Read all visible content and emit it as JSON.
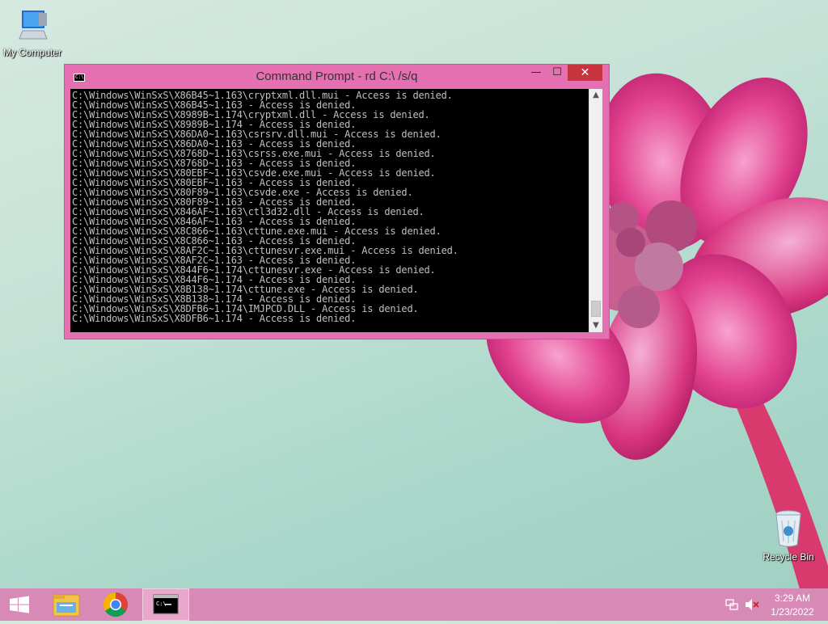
{
  "desktop": {
    "icons": [
      {
        "label": "My Computer"
      },
      {
        "label": "Recycle Bin"
      }
    ]
  },
  "window": {
    "title": "Command Prompt - rd  C:\\ /s/q",
    "controls": {
      "minimize": "—",
      "maximize": "☐",
      "close": "✕"
    },
    "console_lines": [
      "C:\\Windows\\WinSxS\\X86B45~1.163\\cryptxml.dll.mui - Access is denied.",
      "C:\\Windows\\WinSxS\\X86B45~1.163 - Access is denied.",
      "C:\\Windows\\WinSxS\\X8989B~1.174\\cryptxml.dll - Access is denied.",
      "C:\\Windows\\WinSxS\\X8989B~1.174 - Access is denied.",
      "C:\\Windows\\WinSxS\\X86DA0~1.163\\csrsrv.dll.mui - Access is denied.",
      "C:\\Windows\\WinSxS\\X86DA0~1.163 - Access is denied.",
      "C:\\Windows\\WinSxS\\X8768D~1.163\\csrss.exe.mui - Access is denied.",
      "C:\\Windows\\WinSxS\\X8768D~1.163 - Access is denied.",
      "C:\\Windows\\WinSxS\\X80EBF~1.163\\csvde.exe.mui - Access is denied.",
      "C:\\Windows\\WinSxS\\X80EBF~1.163 - Access is denied.",
      "C:\\Windows\\WinSxS\\X80F89~1.163\\csvde.exe - Access is denied.",
      "C:\\Windows\\WinSxS\\X80F89~1.163 - Access is denied.",
      "C:\\Windows\\WinSxS\\X846AF~1.163\\ctl3d32.dll - Access is denied.",
      "C:\\Windows\\WinSxS\\X846AF~1.163 - Access is denied.",
      "C:\\Windows\\WinSxS\\X8C866~1.163\\cttune.exe.mui - Access is denied.",
      "C:\\Windows\\WinSxS\\X8C866~1.163 - Access is denied.",
      "C:\\Windows\\WinSxS\\X8AF2C~1.163\\cttunesvr.exe.mui - Access is denied.",
      "C:\\Windows\\WinSxS\\X8AF2C~1.163 - Access is denied.",
      "C:\\Windows\\WinSxS\\X844F6~1.174\\cttunesvr.exe - Access is denied.",
      "C:\\Windows\\WinSxS\\X844F6~1.174 - Access is denied.",
      "C:\\Windows\\WinSxS\\X8B138~1.174\\cttune.exe - Access is denied.",
      "C:\\Windows\\WinSxS\\X8B138~1.174 - Access is denied.",
      "C:\\Windows\\WinSxS\\X8DFB6~1.174\\IMJPCD.DLL - Access is denied.",
      "C:\\Windows\\WinSxS\\X8DFB6~1.174 - Access is denied."
    ]
  },
  "taskbar": {
    "items": [
      {
        "name": "start-button",
        "icon": "windows-logo-icon"
      },
      {
        "name": "file-explorer",
        "icon": "folder-icon"
      },
      {
        "name": "chrome",
        "icon": "chrome-icon"
      },
      {
        "name": "command-prompt",
        "icon": "cmd-icon",
        "active": true
      }
    ],
    "tray": {
      "time": "3:29 AM",
      "date": "1/23/2022",
      "network_icon": "network-icon",
      "volume_icon": "volume-muted-icon"
    }
  },
  "colors": {
    "window_frame": "#e46fb1",
    "close_button": "#c7343d",
    "taskbar": "#d78ab6",
    "console_bg": "#000000",
    "console_text": "#c0c0c0"
  }
}
